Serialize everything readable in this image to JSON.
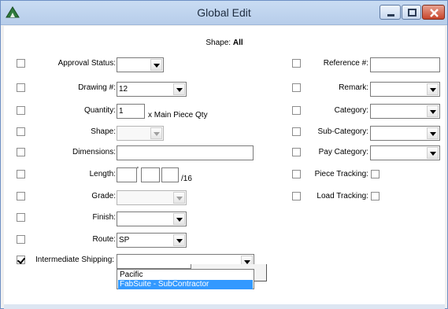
{
  "window": {
    "title": "Global Edit",
    "app_icon": "triangle-app-icon"
  },
  "header": {
    "shape_label": "Shape:",
    "shape_value": "All"
  },
  "left_fields": {
    "approval_status": {
      "label": "Approval Status:",
      "value": ""
    },
    "drawing": {
      "label": "Drawing #:",
      "value": "12"
    },
    "quantity": {
      "label": "Quantity:",
      "value": "1",
      "suffix": "x Main Piece Qty"
    },
    "shape": {
      "label": "Shape:",
      "value": ""
    },
    "dimensions": {
      "label": "Dimensions:",
      "value": ""
    },
    "length": {
      "label": "Length:",
      "feet": "",
      "inches": "",
      "sixteenths": "",
      "feet_mark": "'",
      "suffix": "/16"
    },
    "grade": {
      "label": "Grade:",
      "value": ""
    },
    "finish": {
      "label": "Finish:",
      "value": ""
    },
    "route": {
      "label": "Route:",
      "value": "SP"
    },
    "intermediate_shipping": {
      "label": "Intermediate Shipping:",
      "value": "",
      "checked": true
    }
  },
  "right_fields": {
    "reference": {
      "label": "Reference #:",
      "value": ""
    },
    "remark": {
      "label": "Remark:",
      "value": ""
    },
    "category": {
      "label": "Category:",
      "value": ""
    },
    "sub_category": {
      "label": "Sub-Category:",
      "value": ""
    },
    "pay_category": {
      "label": "Pay Category:",
      "value": ""
    },
    "piece_tracking": {
      "label": "Piece Tracking:"
    },
    "load_tracking": {
      "label": "Load Tracking:"
    }
  },
  "dropdown_open": {
    "options": [
      "Pacific",
      "FabSuite - SubContractor"
    ],
    "selected_index": 1
  },
  "partial_button": {
    "label": ""
  }
}
